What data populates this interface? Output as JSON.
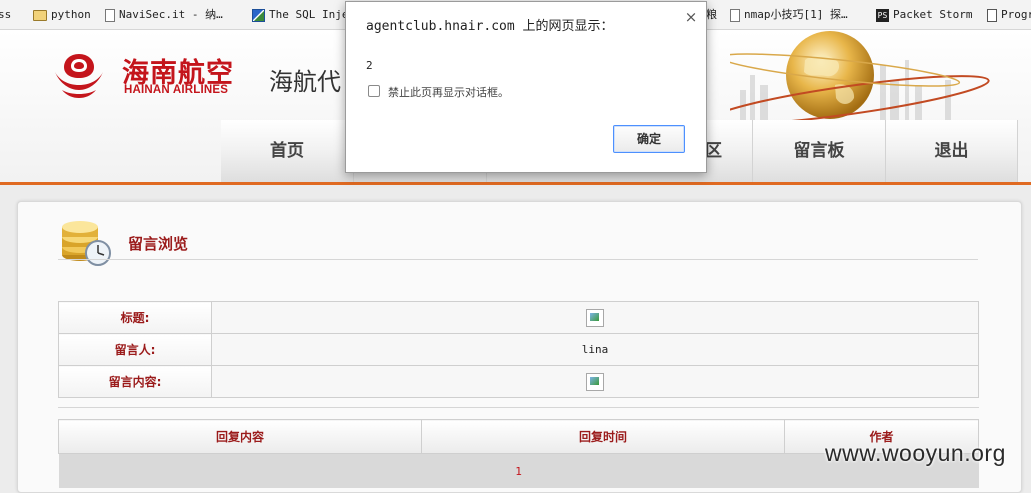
{
  "bookmarks": [
    {
      "label": "ss",
      "icon": "folder-icon"
    },
    {
      "label": "python",
      "icon": "folder-icon"
    },
    {
      "label": "NaviSec.it - 纳…",
      "icon": "page-icon"
    },
    {
      "label": "The SQL Inje",
      "icon": "sql-icon"
    },
    {
      "label": "粮",
      "icon": "page-icon"
    },
    {
      "label": "nmap小技巧[1] 探…",
      "icon": "page-icon"
    },
    {
      "label": "Packet Storm",
      "icon": "packet-storm-icon"
    },
    {
      "label": "Progr",
      "icon": "page-icon"
    }
  ],
  "site": {
    "logo_cn": "海南航空",
    "logo_en": "HAINAN AIRLINES",
    "title": "海航代",
    "brand_color": "#c4151c"
  },
  "nav": {
    "items": [
      "首页",
      "",
      "",
      "",
      "区",
      "留言板",
      "退出"
    ]
  },
  "section": {
    "title": "留言浏览"
  },
  "message": {
    "title_label": "标题:",
    "author_label": "留言人:",
    "author": "lina",
    "content_label": "留言内容:"
  },
  "replies": {
    "headers": [
      "回复内容",
      "回复时间",
      "作者"
    ],
    "rows": [
      {
        "content": "1",
        "time": "",
        "author": ""
      }
    ]
  },
  "watermark": "www.wooyun.org",
  "dialog": {
    "title": "agentclub.hnair.com 上的网页显示：",
    "message": "2",
    "checkbox_label": "禁止此页再显示对话框。",
    "ok_label": "确定",
    "close_glyph": "×"
  }
}
